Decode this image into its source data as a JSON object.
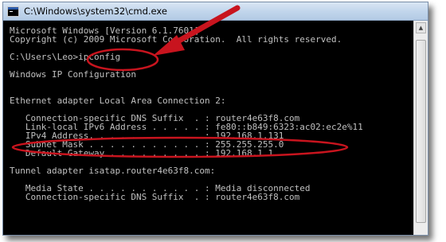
{
  "window": {
    "title": "C:\\Windows\\system32\\cmd.exe"
  },
  "console": {
    "lines": [
      "Microsoft Windows [Version 6.1.7601]",
      "Copyright (c) 2009 Microsoft Corporation.  All rights reserved.",
      "",
      "C:\\Users\\Leo>ipconfig",
      "",
      "Windows IP Configuration",
      "",
      "",
      "Ethernet adapter Local Area Connection 2:",
      "",
      "   Connection-specific DNS Suffix  . : router4e63f8.com",
      "   Link-local IPv6 Address . . . . . : fe80::b849:6323:ac02:ec2e%11",
      "   IPv4 Address. . . . . . . . . . . : 192.168.1.131",
      "   Subnet Mask . . . . . . . . . . . : 255.255.255.0",
      "   Default Gateway . . . . . . . . . : 192.168.1.1",
      "",
      "Tunnel adapter isatap.router4e63f8.com:",
      "",
      "   Media State . . . . . . . . . . . : Media disconnected",
      "   Connection-specific DNS Suffix  . : router4e63f8.com"
    ]
  },
  "annotations": {
    "color": "#c8141e"
  },
  "colors": {
    "console_bg": "#000000",
    "console_text": "#c0c0c0"
  }
}
